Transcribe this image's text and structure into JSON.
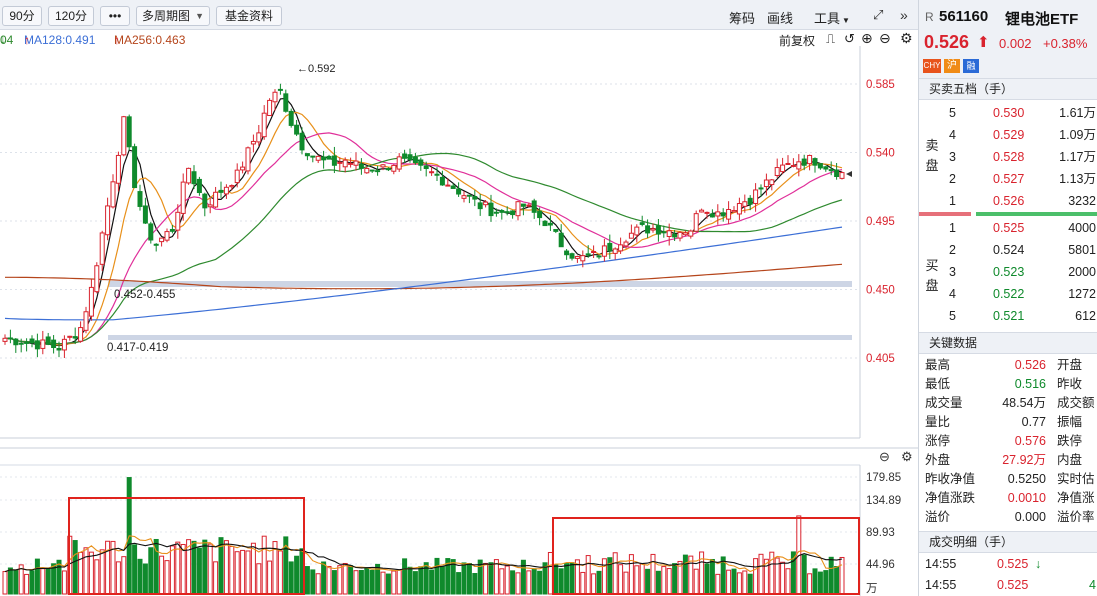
{
  "toolbar": {
    "period_90": "90分",
    "period_120": "120分",
    "more": "•••",
    "multi_period": "多周期图",
    "fund_info": "基金资料",
    "chip": "筹码",
    "draw": "画线",
    "tools": "工具",
    "expand_icon": "expand-icon",
    "collapse_icon": "double-chevron-right-icon"
  },
  "legend": {
    "ma64_partial": "04",
    "ma128": "MA128:0.491",
    "ma256": "MA256:0.463"
  },
  "chart_tools": {
    "adjust": "前复权"
  },
  "price_axis": [
    "0.585",
    "0.540",
    "0.495",
    "0.450",
    "0.405"
  ],
  "volume_axis": [
    "179.85",
    "134.89",
    "89.93",
    "44.96",
    "万"
  ],
  "annotations": {
    "high": "←0.592",
    "zone_upper": "0.452-0.455",
    "zone_lower": "0.417-0.419"
  },
  "colors": {
    "up": "#d9232e",
    "down": "#0f8a2c",
    "ma_black": "#111111",
    "ma_orange": "#e8901a",
    "ma_pink": "#e0309a",
    "ma_green": "#2f8a2f",
    "ma_blue": "#3c6fd6",
    "ma_brown": "#b5451b"
  },
  "quote": {
    "market": "R",
    "code": "561160",
    "name": "锂电池ETF",
    "price": "0.526",
    "change": "0.002",
    "pct": "+0.38%",
    "tags": [
      "CHY",
      "沪",
      "融"
    ]
  },
  "orderbook": {
    "title": "买卖五档（手）",
    "sell_label": "卖盘",
    "buy_label": "买盘",
    "sell": [
      {
        "level": "5",
        "price": "0.530",
        "vol": "1.61万"
      },
      {
        "level": "4",
        "price": "0.529",
        "vol": "1.09万"
      },
      {
        "level": "3",
        "price": "0.528",
        "vol": "1.17万"
      },
      {
        "level": "2",
        "price": "0.527",
        "vol": "1.13万"
      },
      {
        "level": "1",
        "price": "0.526",
        "vol": "3232"
      }
    ],
    "buy": [
      {
        "level": "1",
        "price": "0.525",
        "vol": "4000"
      },
      {
        "level": "2",
        "price": "0.524",
        "vol": "5801"
      },
      {
        "level": "3",
        "price": "0.523",
        "vol": "2000"
      },
      {
        "level": "4",
        "price": "0.522",
        "vol": "1272"
      },
      {
        "level": "5",
        "price": "0.521",
        "vol": "612"
      }
    ]
  },
  "key_data": {
    "title": "关键数据",
    "rows": [
      {
        "l1": "最高",
        "v1": "0.526",
        "l2": "开盘"
      },
      {
        "l1": "最低",
        "v1": "0.516",
        "l2": "昨收"
      },
      {
        "l1": "成交量",
        "v1": "48.54万",
        "l2": "成交额"
      },
      {
        "l1": "量比",
        "v1": "0.77",
        "l2": "振幅"
      },
      {
        "l1": "涨停",
        "v1": "0.576",
        "l2": "跌停"
      },
      {
        "l1": "外盘",
        "v1": "27.92万",
        "l2": "内盘"
      },
      {
        "l1": "昨收净值",
        "v1": "0.5250",
        "l2": "实时估"
      },
      {
        "l1": "净值涨跌",
        "v1": "0.0010",
        "l2": "净值涨"
      },
      {
        "l1": "溢价",
        "v1": "0.000",
        "l2": "溢价率"
      }
    ]
  },
  "trades": {
    "title": "成交明细（手）",
    "rows": [
      {
        "time": "14:55",
        "price": "0.525",
        "dir": "down-arrow-icon",
        "vol": ""
      },
      {
        "time": "14:55",
        "price": "0.525",
        "dir": "",
        "vol": "4"
      }
    ]
  }
}
